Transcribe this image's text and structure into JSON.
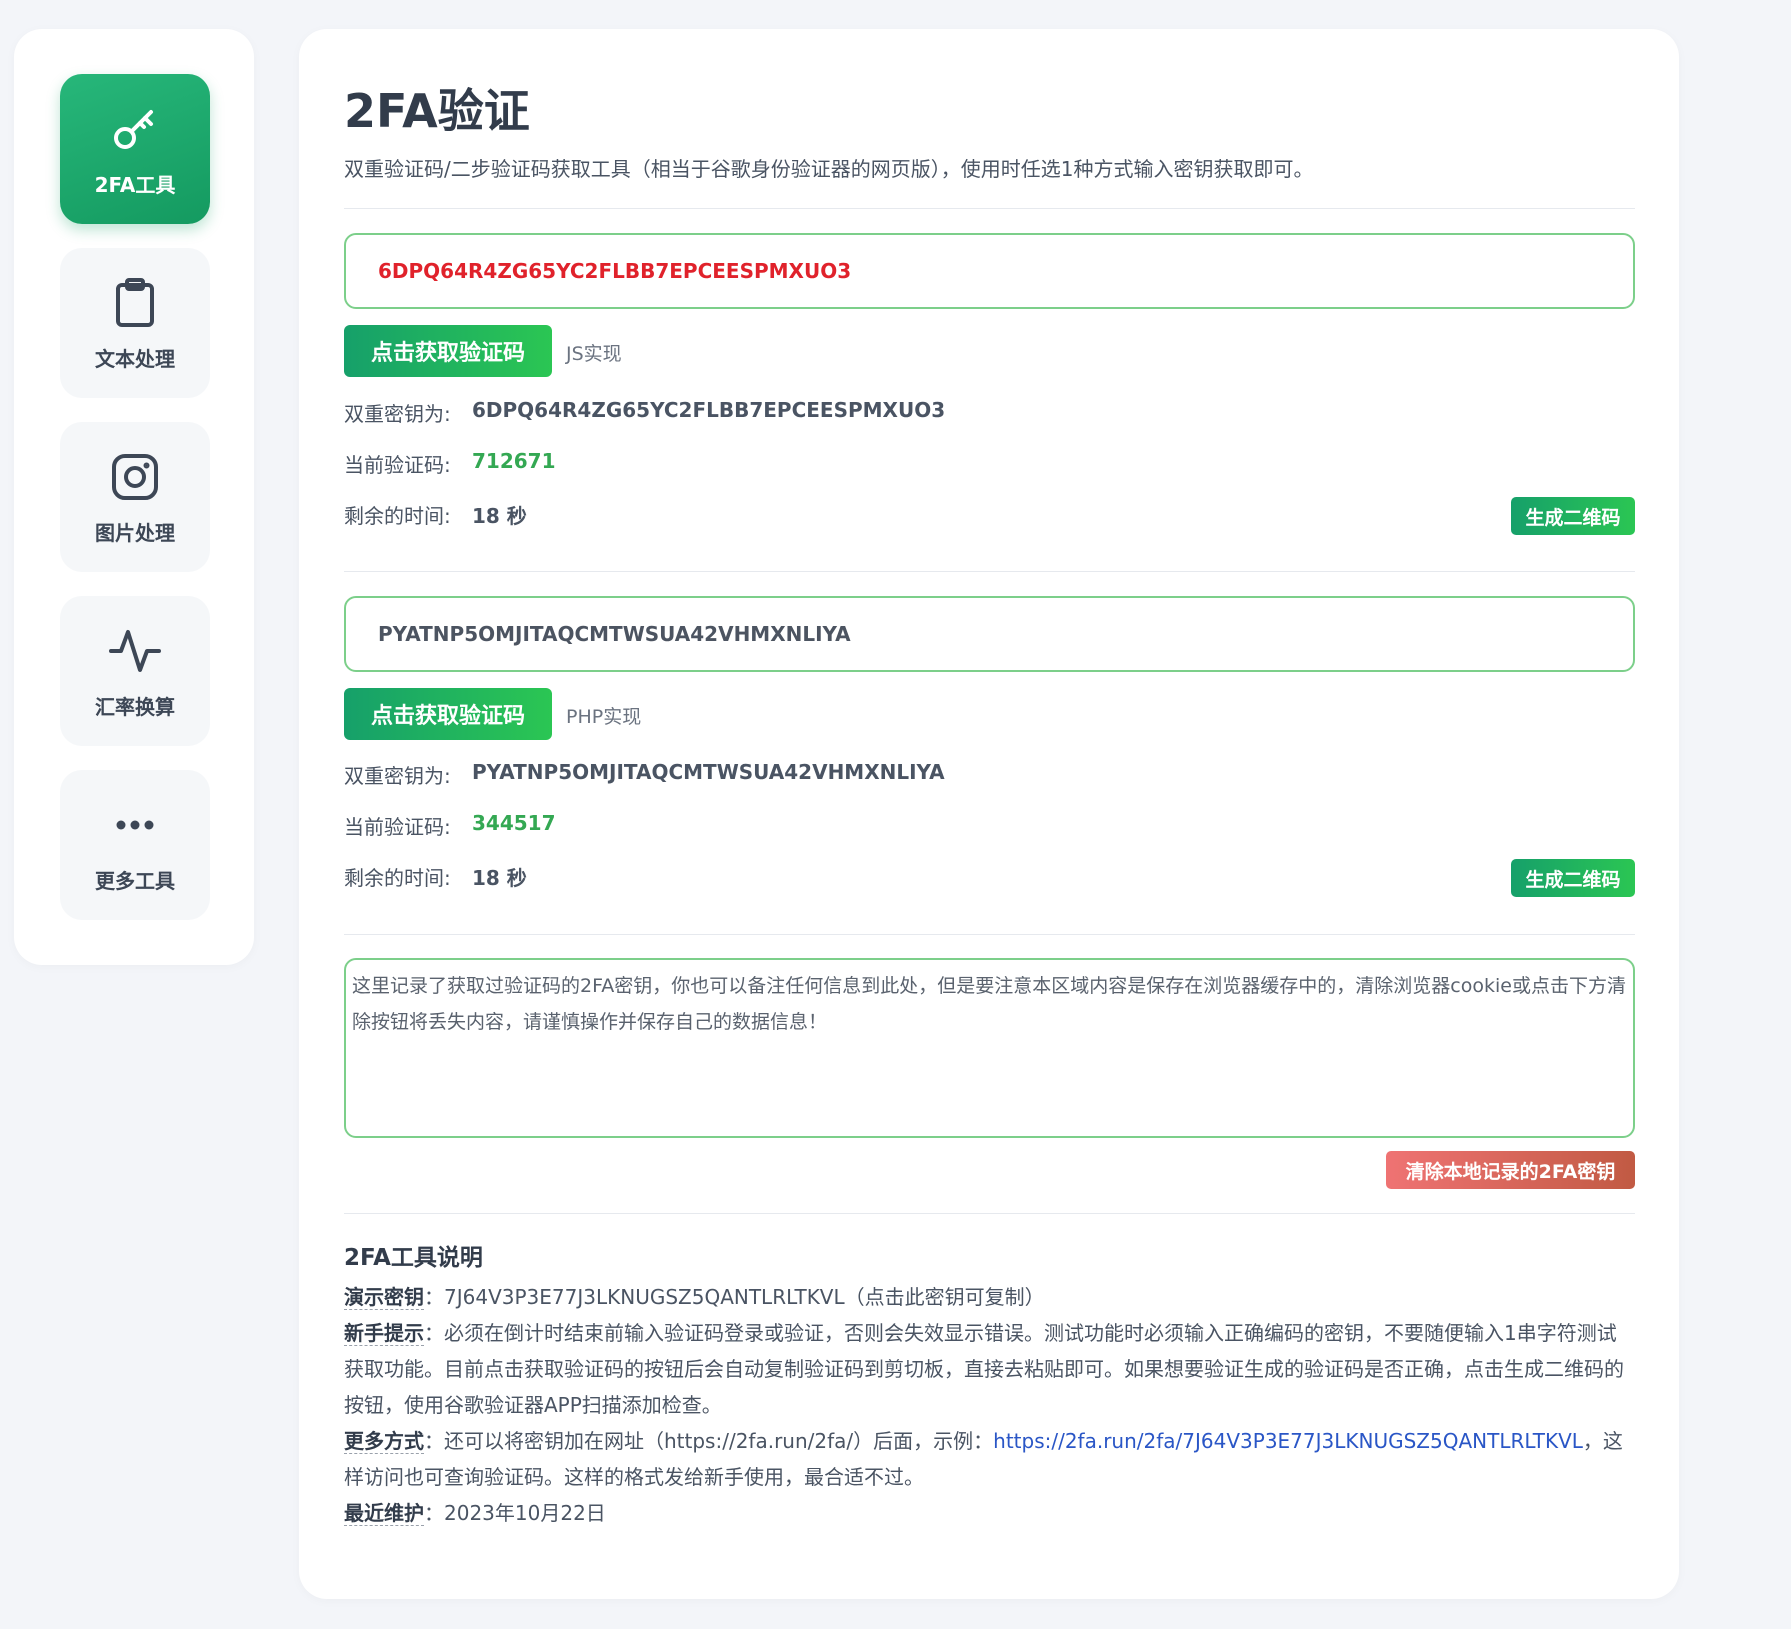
{
  "sidebar": {
    "items": [
      {
        "label": "2FA工具",
        "icon": "key-icon"
      },
      {
        "label": "文本处理",
        "icon": "clipboard-icon"
      },
      {
        "label": "图片处理",
        "icon": "instagram-icon"
      },
      {
        "label": "汇率换算",
        "icon": "activity-icon"
      },
      {
        "label": "更多工具",
        "icon": "more-dots-icon"
      }
    ]
  },
  "header": {
    "title": "2FA验证",
    "subtitle": "双重验证码/二步验证码获取工具（相当于谷歌身份验证器的网页版），使用时任选1种方式输入密钥获取即可。"
  },
  "js_block": {
    "input_value": "6DPQ64R4ZG65YC2FLBB7EPCEESPMXUO3",
    "button_label": "点击获取验证码",
    "impl_label": "JS实现",
    "secret_label": "双重密钥为:",
    "secret_value": "6DPQ64R4ZG65YC2FLBB7EPCEESPMXUO3",
    "code_label": "当前验证码:",
    "code_value": "712671",
    "time_label": "剩余的时间:",
    "time_value": "18 秒",
    "qr_button_label": "生成二维码"
  },
  "php_block": {
    "input_value": "PYATNP5OMJITAQCMTWSUA42VHMXNLIYA",
    "button_label": "点击获取验证码",
    "impl_label": "PHP实现",
    "secret_label": "双重密钥为:",
    "secret_value": "PYATNP5OMJITAQCMTWSUA42VHMXNLIYA",
    "code_label": "当前验证码:",
    "code_value": "344517",
    "time_label": "剩余的时间:",
    "time_value": "18 秒",
    "qr_button_label": "生成二维码"
  },
  "notes": {
    "placeholder": "这里记录了获取过验证码的2FA密钥，你也可以备注任何信息到此处，但是要注意本区域内容是保存在浏览器缓存中的，清除浏览器cookie或点击下方清除按钮将丢失内容，请谨慎操作并保存自己的数据信息！",
    "clear_button_label": "清除本地记录的2FA密钥"
  },
  "help": {
    "title": "2FA工具说明",
    "demo_label": "演示密钥",
    "demo_text": "：7J64V3P3E77J3LKNUGSZ5QANTLRLTKVL（点击此密钥可复制）",
    "tip_label": "新手提示",
    "tip_text": "：必须在倒计时结束前输入验证码登录或验证，否则会失效显示错误。测试功能时必须输入正确编码的密钥，不要随便输入1串字符测试获取功能。目前点击获取验证码的按钮后会自动复制验证码到剪切板，直接去粘贴即可。如果想要验证生成的验证码是否正确，点击生成二维码的按钮，使用谷歌验证器APP扫描添加检查。",
    "more_label": "更多方式",
    "more_text_before": "：还可以将密钥加在网址（https://2fa.run/2fa/）后面，示例：",
    "more_link": "https://2fa.run/2fa/7J64V3P3E77J3LKNUGSZ5QANTLRLTKVL",
    "more_text_after": "，这样访问也可查询验证码。这样的格式发给新手使用，最合适不过。",
    "maint_label": "最近维护",
    "maint_text": "：2023年10月22日"
  }
}
